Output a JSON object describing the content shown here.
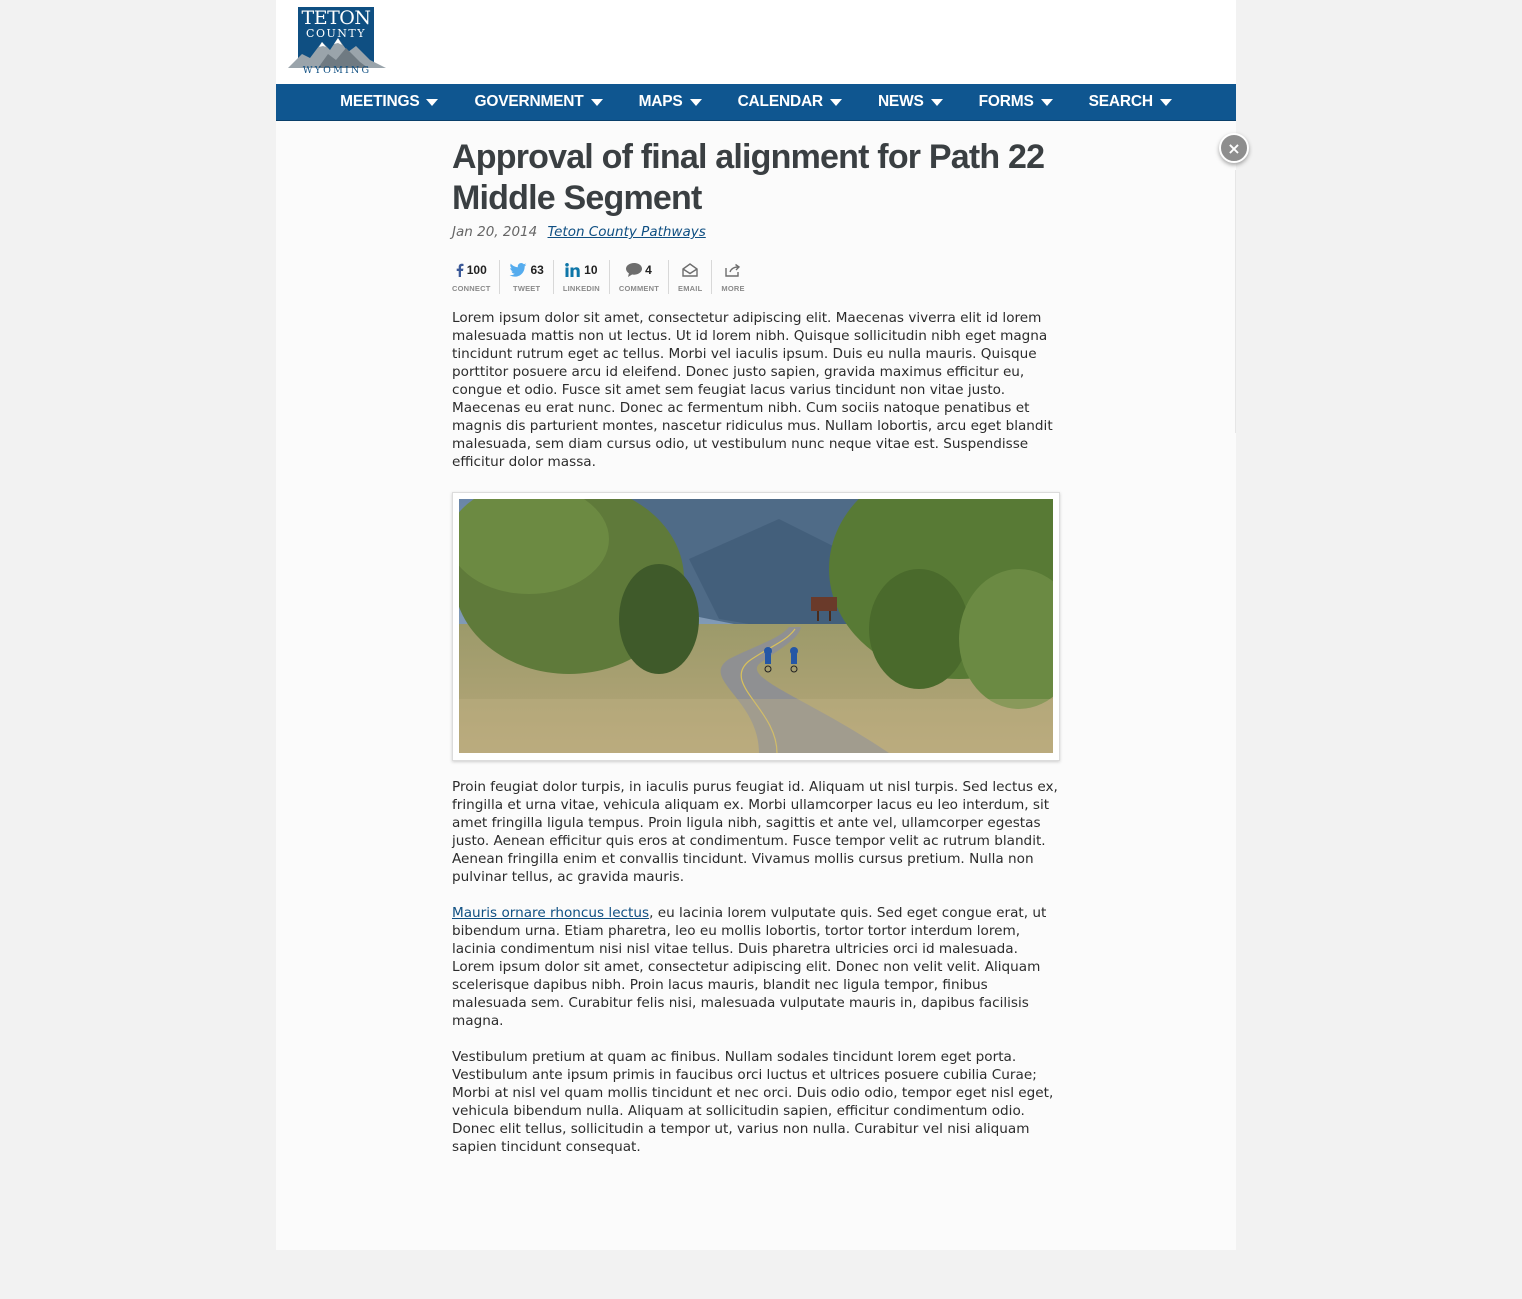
{
  "logo": {
    "line1": "TETON",
    "line2": "COUNTY",
    "line3": "WYOMING"
  },
  "nav": {
    "items": [
      {
        "label": "MEETINGS"
      },
      {
        "label": "GOVERNMENT"
      },
      {
        "label": "MAPS"
      },
      {
        "label": "CALENDAR"
      },
      {
        "label": "NEWS"
      },
      {
        "label": "FORMS"
      },
      {
        "label": "SEARCH"
      }
    ]
  },
  "close": {
    "label": "×"
  },
  "article": {
    "title": "Approval of final alignment for Path 22 Middle Segment",
    "date": "Jan 20, 2014",
    "source": "Teton County Pathways",
    "share": [
      {
        "icon": "facebook-icon",
        "count": "100",
        "label": "CONNECT"
      },
      {
        "icon": "twitter-icon",
        "count": "63",
        "label": "TWEET"
      },
      {
        "icon": "linkedin-icon",
        "count": "10",
        "label": "LINKEDIN"
      },
      {
        "icon": "comment-icon",
        "count": "4",
        "label": "COMMENT"
      },
      {
        "icon": "email-icon",
        "count": "",
        "label": "EMAIL"
      },
      {
        "icon": "share-icon",
        "count": "",
        "label": "MORE"
      }
    ],
    "paragraph1": "Lorem ipsum dolor sit amet, consectetur adipiscing elit. Maecenas viverra elit id lorem malesuada mattis non ut lectus. Ut id lorem nibh. Quisque sollicitudin nibh eget magna tincidunt rutrum eget ac tellus. Morbi vel iaculis ipsum. Duis eu nulla mauris. Quisque porttitor posuere arcu id eleifend. Donec justo sapien, gravida maximus efficitur eu, congue et odio. Fusce sit amet sem feugiat lacus varius tincidunt non vitae justo. Maecenas eu erat nunc. Donec ac fermentum nibh. Cum sociis natoque penatibus et magnis dis parturient montes, nascetur ridiculus mus. Nullam lobortis, arcu eget blandit malesuada, sem diam cursus odio, ut vestibulum nunc neque vitae est. Suspendisse efficitur dolor massa.",
    "paragraph2": "Proin feugiat dolor turpis, in iaculis purus feugiat id. Aliquam ut nisl turpis. Sed lectus ex, fringilla et urna vitae, vehicula aliquam ex. Morbi ullamcorper lacus eu leo interdum, sit amet fringilla ligula tempus. Proin ligula nibh, sagittis et ante vel, ullamcorper egestas justo. Aenean efficitur quis eros at condimentum. Fusce tempor velit ac rutrum blandit. Aenean fringilla enim et convallis tincidunt. Vivamus mollis cursus pretium. Nulla non pulvinar tellus, ac gravida mauris.",
    "paragraph3_link": "Mauris ornare rhoncus lectus",
    "paragraph3_rest": ", eu lacinia lorem vulputate quis. Sed eget congue erat, ut bibendum urna. Etiam pharetra, leo eu mollis lobortis, tortor tortor interdum lorem, lacinia condimentum nisi nisl vitae tellus. Duis pharetra ultricies orci id malesuada. Lorem ipsum dolor sit amet, consectetur adipiscing elit. Donec non velit velit. Aliquam scelerisque dapibus nibh. Proin lacus mauris, blandit nec ligula tempor, finibus malesuada sem. Curabitur felis nisi, malesuada vulputate mauris in, dapibus facilisis magna.",
    "paragraph4": "Vestibulum pretium at quam ac finibus. Nullam sodales tincidunt lorem eget porta. Vestibulum ante ipsum primis in faucibus orci luctus et ultrices posuere cubilia Curae; Morbi at nisl vel quam mollis tincidunt et nec orci. Duis odio odio, tempor eget nisl eget, vehicula bibendum nulla. Aliquam at sollicitudin sapien, efficitur condimentum odio. Donec elit tellus, sollicitudin a tempor ut, varius non nulla. Curabitur vel nisi aliquam sapien tincidunt consequat."
  },
  "colors": {
    "brand": "#0f5690",
    "link": "#0f4f82",
    "title": "#3a3f42"
  }
}
